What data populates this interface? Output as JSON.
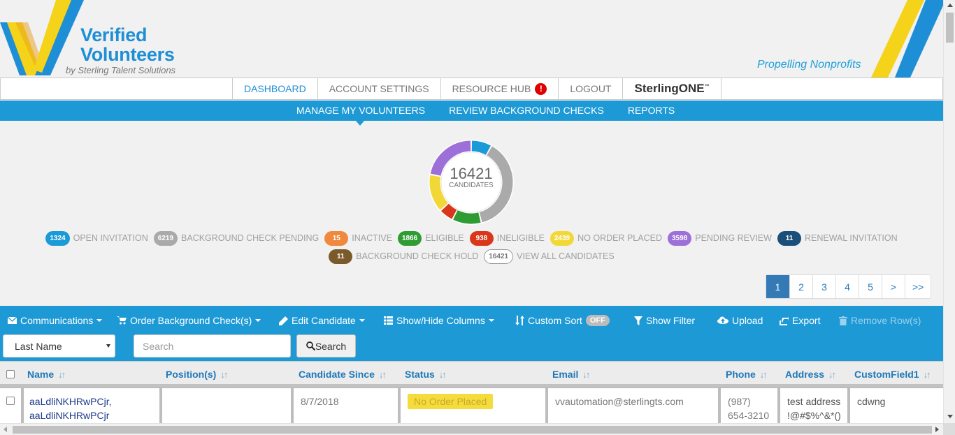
{
  "brand": {
    "title_line1": "Verified",
    "title_line2": "Volunteers",
    "subtitle": "by Sterling Talent Solutions",
    "tagline": "Propelling Nonprofits"
  },
  "topnav": {
    "items": [
      {
        "label": "DASHBOARD",
        "active": true
      },
      {
        "label": "ACCOUNT SETTINGS"
      },
      {
        "label": "RESOURCE HUB",
        "alert": "!"
      },
      {
        "label": "LOGOUT"
      }
    ],
    "sterling": {
      "prefix": "Sterling",
      "suffix": "ONE",
      "tm": "™"
    }
  },
  "subnav": {
    "items": [
      {
        "label": "MANAGE MY VOLUNTEERS",
        "active": true
      },
      {
        "label": "REVIEW BACKGROUND CHECKS"
      },
      {
        "label": "REPORTS"
      }
    ]
  },
  "summary": {
    "total": "16421",
    "label": "CANDIDATES"
  },
  "chart_data": {
    "type": "pie",
    "title": "",
    "center_text": "16421 CANDIDATES",
    "slices": [
      {
        "label": "OPEN INVITATION",
        "value": 1324,
        "color": "#1a9ad6"
      },
      {
        "label": "BACKGROUND CHECK PENDING",
        "value": 6219,
        "color": "#aaaaaa"
      },
      {
        "label": "ELIGIBLE",
        "value": 1866,
        "color": "#2e9b33"
      },
      {
        "label": "INELIGIBLE",
        "value": 938,
        "color": "#d9361a"
      },
      {
        "label": "NO ORDER PLACED",
        "value": 2439,
        "color": "#f2d837"
      },
      {
        "label": "PENDING REVIEW",
        "value": 3598,
        "color": "#9d6fd8"
      }
    ]
  },
  "legend": {
    "row1": [
      {
        "count": "1324",
        "label": "OPEN INVITATION",
        "color": "#1a9ad6"
      },
      {
        "count": "6219",
        "label": "BACKGROUND CHECK PENDING",
        "color": "#aaaaaa"
      },
      {
        "count": "15",
        "label": "INACTIVE",
        "color": "#f0883e"
      },
      {
        "count": "1866",
        "label": "ELIGIBLE",
        "color": "#2e9b33"
      },
      {
        "count": "938",
        "label": "INELIGIBLE",
        "color": "#d9361a"
      },
      {
        "count": "2439",
        "label": "NO ORDER PLACED",
        "color": "#f2d837"
      },
      {
        "count": "3598",
        "label": "PENDING REVIEW",
        "color": "#9d6fd8"
      },
      {
        "count": "11",
        "label": "RENEWAL INVITATION",
        "color": "#1a4f7a"
      }
    ],
    "row2": [
      {
        "count": "11",
        "label": "BACKGROUND CHECK HOLD",
        "color": "#7a5a2a"
      },
      {
        "count": "16421",
        "label": "VIEW ALL CANDIDATES",
        "color": "outline"
      }
    ]
  },
  "pagination": [
    "1",
    "2",
    "3",
    "4",
    "5",
    ">",
    ">>"
  ],
  "pagination_active": "1",
  "toolbar": {
    "communications": "Communications",
    "order": "Order Background Check(s)",
    "edit": "Edit Candidate",
    "columns": "Show/Hide Columns",
    "sort": "Custom Sort",
    "sort_state": "OFF",
    "filter": "Show Filter",
    "upload": "Upload",
    "export": "Export",
    "remove": "Remove Row(s)"
  },
  "search": {
    "field_selected": "Last Name",
    "placeholder": "Search",
    "button": "Search"
  },
  "table": {
    "columns": [
      "Name",
      "Position(s)",
      "Candidate Since",
      "Status",
      "Email",
      "Phone",
      "Address",
      "CustomField1"
    ],
    "rows": [
      {
        "name_line1": "aaLdliNKHRwPCjr,",
        "name_line2": "aaLdliNKHRwPCjr",
        "positions": "",
        "since": "8/7/2018",
        "status": "No Order Placed",
        "email": "vvautomation@sterlingts.com",
        "phone_line1": "(987)",
        "phone_line2": "654-3210",
        "address_line1": "test address",
        "address_line2": "!@#$%^&*()",
        "custom1": "cdwng"
      }
    ]
  }
}
